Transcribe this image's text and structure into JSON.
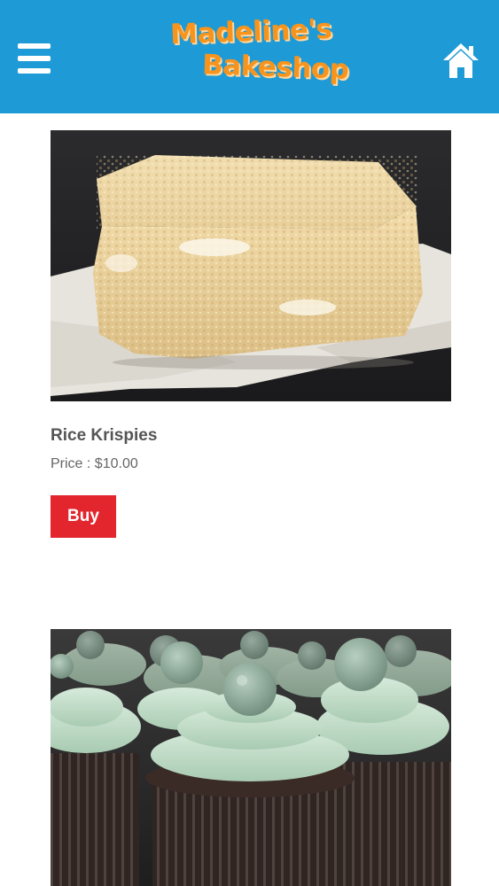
{
  "header": {
    "menu_icon": "hamburger-menu-icon",
    "logo_line1": "Madeline's",
    "logo_line2": "Bakeshop",
    "home_icon": "home-icon",
    "background_color": "#1e9ad6",
    "logo_color": "#f7941d"
  },
  "products": [
    {
      "name": "Rice Krispies",
      "price_label": "Price : ",
      "price": "$10.00",
      "buy_label": "Buy"
    },
    {
      "image": "mint-chocolate-cupcakes"
    }
  ],
  "buy_button_color": "#e3252e"
}
